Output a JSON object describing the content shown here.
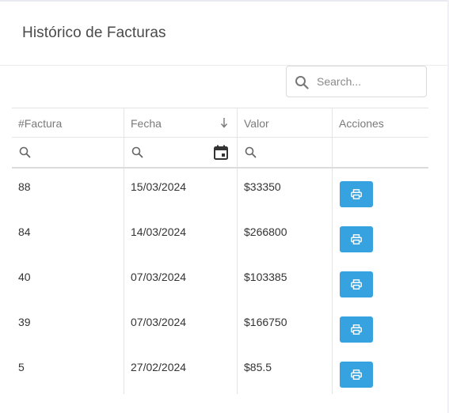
{
  "header": {
    "title": "Histórico de Facturas"
  },
  "search": {
    "placeholder": "Search..."
  },
  "table": {
    "columns": [
      "#Factura",
      "Fecha",
      "Valor",
      "Acciones"
    ],
    "sorted_column": "Fecha",
    "sort_direction": "descending",
    "rows": [
      {
        "factura": "88",
        "fecha": "15/03/2024",
        "valor": "$33350"
      },
      {
        "factura": "84",
        "fecha": "14/03/2024",
        "valor": "$266800"
      },
      {
        "factura": "40",
        "fecha": "07/03/2024",
        "valor": "$103385"
      },
      {
        "factura": "39",
        "fecha": "07/03/2024",
        "valor": "$166750"
      },
      {
        "factura": "5",
        "fecha": "27/02/2024",
        "valor": "$85.5"
      }
    ],
    "action_icon": "printer-icon"
  },
  "colors": {
    "accent": "#36a3e0",
    "title": "#4a4a4a",
    "text": "#333333",
    "muted": "#7a7a7a",
    "border": "#e4e4e4"
  },
  "icons": {
    "search": "search-icon",
    "sort": "arrow-down-icon",
    "calendar": "calendar-icon",
    "print": "printer-icon"
  }
}
